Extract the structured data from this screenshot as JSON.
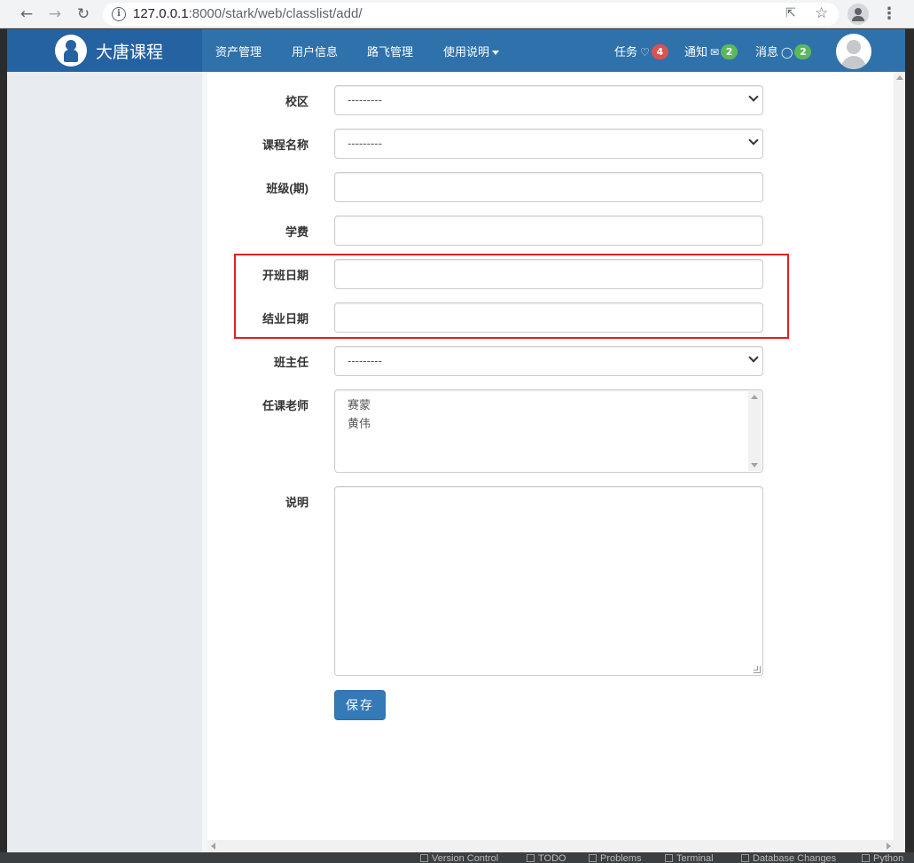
{
  "browser": {
    "url_host": "127.0.0.1",
    "url_path": ":8000/stark/web/classlist/add/",
    "back_icon": "arrow-left-icon",
    "forward_icon": "arrow-right-icon",
    "reload_icon": "reload-icon"
  },
  "header": {
    "brand_title": "大唐课程",
    "menu": [
      {
        "label": "资产管理"
      },
      {
        "label": "用户信息"
      },
      {
        "label": "路飞管理"
      },
      {
        "label": "使用说明"
      }
    ],
    "tasks": {
      "label": "任务",
      "count": "4"
    },
    "notices": {
      "label": "通知",
      "count": "2"
    },
    "messages": {
      "label": "消息",
      "count": "2"
    }
  },
  "form": {
    "campus": {
      "label": "校区",
      "value": "---------"
    },
    "course": {
      "label": "课程名称",
      "value": "---------"
    },
    "semester": {
      "label": "班级(期)",
      "value": ""
    },
    "price": {
      "label": "学费",
      "value": ""
    },
    "start_date": {
      "label": "开班日期",
      "value": ""
    },
    "graduate_date": {
      "label": "结业日期",
      "value": ""
    },
    "tutor": {
      "label": "班主任",
      "value": "---------"
    },
    "teachers": {
      "label": "任课老师",
      "options": [
        "赛蒙",
        "黄伟"
      ]
    },
    "memo": {
      "label": "说明",
      "value": ""
    },
    "save_label": "保存"
  },
  "ide_status": {
    "items": [
      "Version Control",
      "TODO",
      "Problems",
      "Terminal",
      "Database Changes",
      "Python"
    ]
  },
  "colors": {
    "navbar": "#2f72ab",
    "brand_bg": "#2562a1",
    "primary_button": "#337ab7",
    "badge_red": "#d9534f",
    "badge_green": "#5cb85c",
    "highlight": "#e02020"
  }
}
